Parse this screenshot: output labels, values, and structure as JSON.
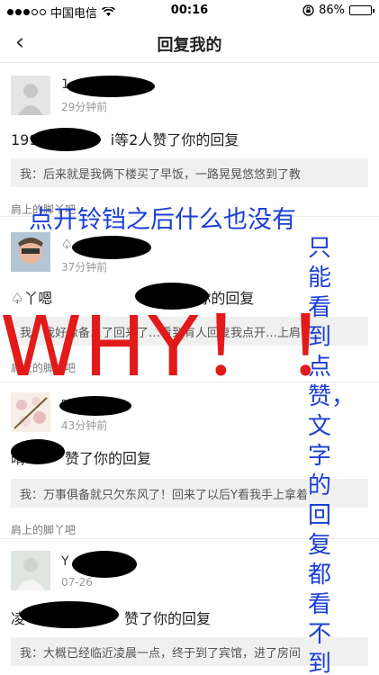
{
  "status_bar": {
    "carrier": "中国电信",
    "time": "00:16",
    "battery": "86%",
    "battery_level": 0.86
  },
  "nav": {
    "title": "回复我的"
  },
  "cards": [
    {
      "name": "1",
      "time": "29分钟前",
      "action_prefix": "1999",
      "action_suffix": "i等2人赞了你的回复",
      "quote": "我：后来就是我俩下楼买了早饭，一路晃晃悠悠到了教",
      "source": "肩上的脚丫吧"
    },
    {
      "name": "♤",
      "time": "37分钟前",
      "action_prefix": "♤丫嗯",
      "action_suffix": "你的回复",
      "quote": "我：我好像备…了回来了…看到有人回复我点开…上肩",
      "source": "肩上的脚丫吧"
    },
    {
      "name": "晴晴",
      "time": "43分钟前",
      "action_prefix": "晴",
      "action_suffix": "赞了你的回复",
      "quote": "我：万事俱备就只欠东风了！回来了以后Y看我手上拿着",
      "source": "肩上的脚丫吧"
    },
    {
      "name": "Y",
      "time": "07-26",
      "action_prefix": "凌",
      "action_suffix": "赞了你的回复",
      "quote": "我：大概已经临近凌晨一点，终于到了宾馆，进了房间",
      "source": ""
    }
  ],
  "overlays": {
    "blue_top": "点开铃铛之后什么也没有",
    "red_big": "WHY！！",
    "blue_vertical": "只能看到点赞，文字的回复都看不到"
  }
}
